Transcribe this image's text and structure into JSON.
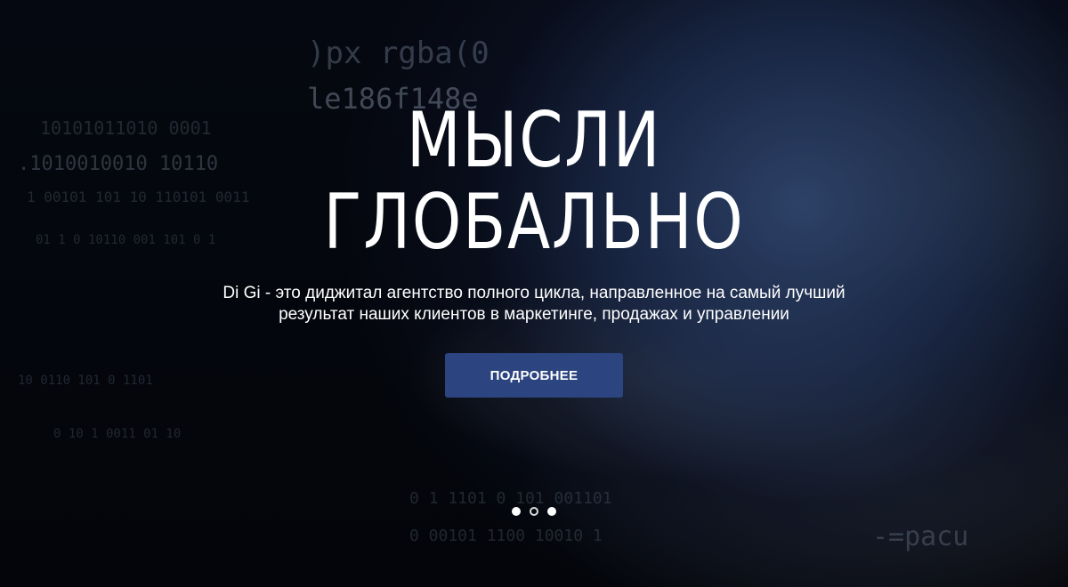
{
  "hero": {
    "title_line1": "МЫСЛИ",
    "title_line2": "ГЛОБАЛЬНО",
    "subtitle_line1": "Di Gi - это диджитал агентство полного цикла, направленное на самый лучший",
    "subtitle_line2": "результат наших клиентов в маркетинге, продажах и управлении",
    "cta_label": "ПОДРОБНЕЕ",
    "button_color": "#2c4580"
  },
  "slider": {
    "slide_count": 3,
    "active_index": 2
  }
}
